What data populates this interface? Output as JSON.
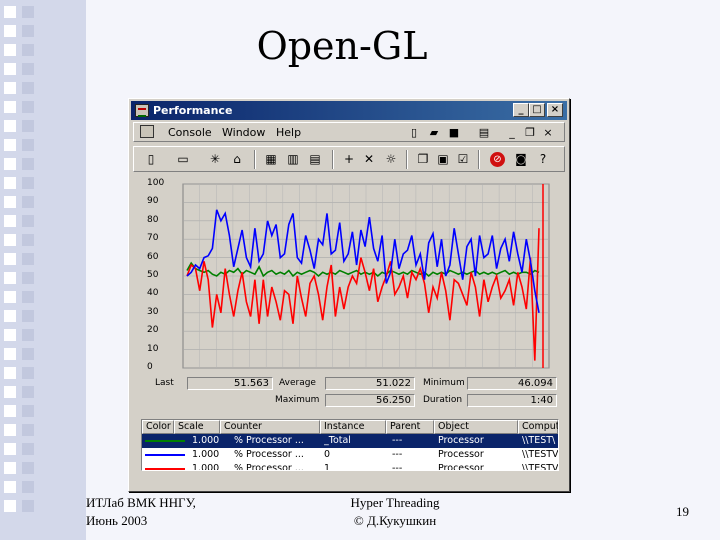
{
  "slide": {
    "title": "Open-GL",
    "footer_left_line1": "ИТЛаб ВМК ННГУ,",
    "footer_left_line2": "Июнь 2003",
    "footer_mid_line1": "Hyper Threading",
    "footer_mid_line2": "© Д.Кукушкин",
    "page_number": "19"
  },
  "window": {
    "title": "Performance",
    "minimize": "_",
    "maximize": "□",
    "close": "×"
  },
  "menu": {
    "items": [
      "Console",
      "Window",
      "Help"
    ]
  },
  "graph": {
    "y_ticks": [
      "100",
      "90",
      "80",
      "70",
      "60",
      "50",
      "40",
      "30",
      "20",
      "10",
      "0"
    ],
    "ylim": [
      0,
      100
    ],
    "colors": {
      "green": "#008000",
      "blue": "#0000ff",
      "red": "#ff0000"
    },
    "series": [
      {
        "name": "green",
        "values": [
          53,
          57,
          54,
          53,
          52,
          53,
          51,
          50,
          52,
          51,
          53,
          52,
          54,
          51,
          53,
          52,
          51,
          55,
          50,
          52,
          53,
          51,
          52,
          51,
          53,
          50,
          52,
          51,
          52,
          53,
          52,
          50,
          52,
          51,
          52,
          51,
          53,
          52,
          51,
          52,
          53,
          51,
          52,
          51,
          52,
          50,
          52,
          51,
          53,
          52,
          51,
          52,
          51,
          53,
          52,
          51,
          52,
          50,
          52,
          51,
          52,
          51,
          53,
          52,
          51,
          52,
          51,
          52,
          53,
          51,
          52,
          51,
          52,
          51,
          52,
          53,
          51,
          52,
          51,
          52,
          52,
          51,
          53,
          52
        ]
      },
      {
        "name": "blue",
        "values": [
          50,
          52,
          56,
          54,
          60,
          61,
          65,
          86,
          80,
          84,
          72,
          55,
          65,
          75,
          60,
          55,
          76,
          58,
          62,
          80,
          72,
          78,
          60,
          62,
          78,
          84,
          60,
          57,
          72,
          64,
          54,
          70,
          67,
          84,
          62,
          64,
          79,
          58,
          62,
          74,
          56,
          75,
          66,
          82,
          65,
          58,
          72,
          46,
          52,
          70,
          54,
          62,
          64,
          72,
          56,
          62,
          48,
          68,
          73,
          55,
          70,
          50,
          56,
          76,
          62,
          48,
          66,
          70,
          50,
          72,
          60,
          62,
          72,
          54,
          65,
          70,
          58,
          74,
          62,
          52,
          70,
          58,
          42,
          30
        ]
      },
      {
        "name": "red",
        "values": [
          50,
          56,
          54,
          42,
          58,
          48,
          22,
          40,
          30,
          54,
          40,
          28,
          42,
          52,
          36,
          28,
          48,
          24,
          48,
          28,
          44,
          36,
          26,
          42,
          40,
          24,
          50,
          38,
          28,
          46,
          50,
          40,
          26,
          44,
          56,
          28,
          44,
          32,
          44,
          50,
          46,
          60,
          52,
          42,
          54,
          36,
          44,
          50,
          58,
          40,
          44,
          50,
          38,
          52,
          48,
          54,
          46,
          30,
          44,
          38,
          52,
          42,
          26,
          48,
          46,
          40,
          34,
          52,
          44,
          28,
          48,
          36,
          44,
          50,
          38,
          42,
          48,
          34,
          52,
          44,
          32,
          60,
          4,
          76
        ]
      }
    ]
  },
  "stats": {
    "last_label": "Last",
    "last_value": "51.563",
    "average_label": "Average",
    "average_value": "51.022",
    "minimum_label": "Minimum",
    "minimum_value": "46.094",
    "maximum_label": "Maximum",
    "maximum_value": "56.250",
    "duration_label": "Duration",
    "duration_value": "1:40"
  },
  "legend": {
    "headers": [
      "Color",
      "Scale",
      "Counter",
      "Instance",
      "Parent",
      "Object",
      "Comput"
    ],
    "rows": [
      {
        "color": "#008000",
        "scale": "1.000",
        "counter": "% Processor ...",
        "instance": "_Total",
        "parent": "---",
        "object": "Processor",
        "computer": "\\\\TEST\\"
      },
      {
        "color": "#0000ff",
        "scale": "1.000",
        "counter": "% Processor ...",
        "instance": "0",
        "parent": "---",
        "object": "Processor",
        "computer": "\\\\TESTV"
      },
      {
        "color": "#ff0000",
        "scale": "1.000",
        "counter": "% Processor ...",
        "instance": "1",
        "parent": "---",
        "object": "Processor",
        "computer": "\\\\TESTV"
      }
    ]
  }
}
